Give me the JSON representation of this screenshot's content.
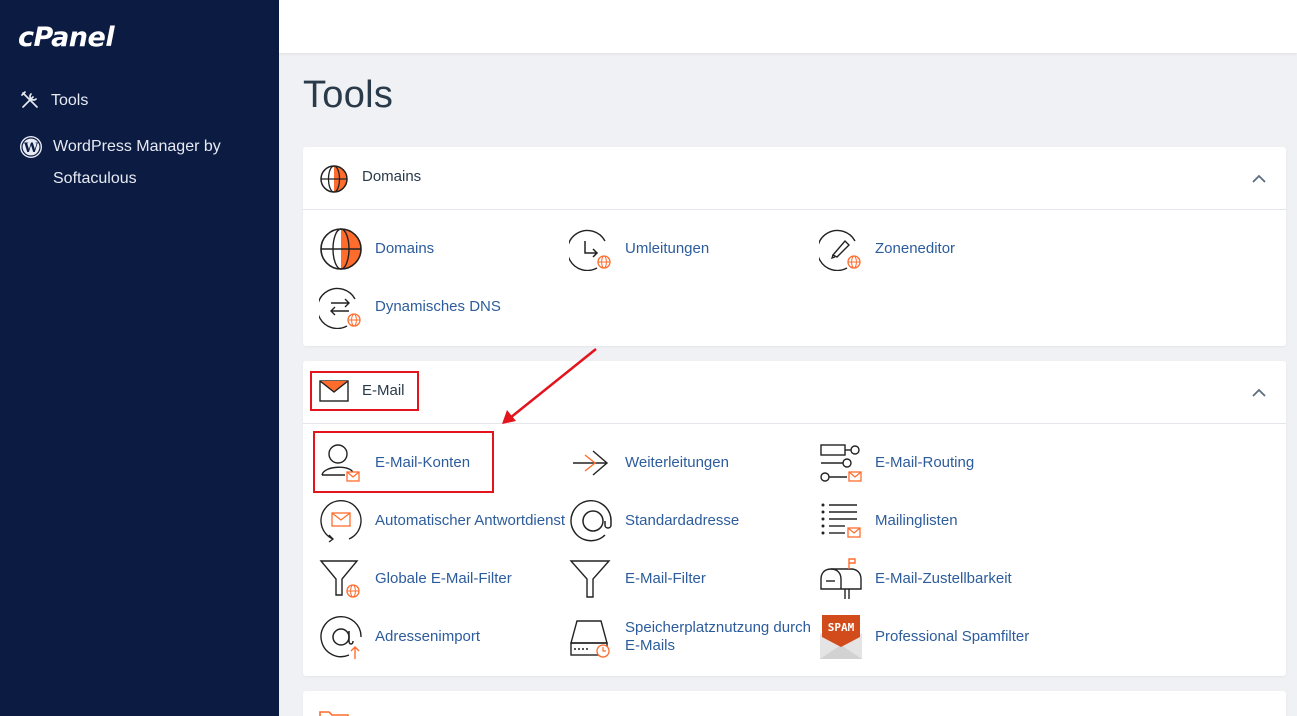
{
  "brand": {
    "logo": "cPanel"
  },
  "sidebar": {
    "items": [
      {
        "label": "Tools",
        "icon": "tools-icon"
      },
      {
        "label": "WordPress Manager by Softaculous",
        "icon": "wordpress-icon"
      }
    ]
  },
  "page": {
    "title": "Tools"
  },
  "sections": {
    "domains": {
      "title": "Domains",
      "tools": [
        {
          "label": "Domains",
          "icon": "globe-icon"
        },
        {
          "label": "Umleitungen",
          "icon": "redirect-icon"
        },
        {
          "label": "Zoneneditor",
          "icon": "zone-editor-icon"
        },
        {
          "label": "Dynamisches DNS",
          "icon": "dynamic-dns-icon"
        }
      ]
    },
    "email": {
      "title": "E-Mail",
      "tools": [
        {
          "label": "E-Mail-Konten",
          "icon": "email-accounts-icon"
        },
        {
          "label": "Weiterleitungen",
          "icon": "forwarders-icon"
        },
        {
          "label": "E-Mail-Routing",
          "icon": "email-routing-icon"
        },
        {
          "label": "Automatischer Antwortdienst",
          "icon": "autoresponder-icon"
        },
        {
          "label": "Standardadresse",
          "icon": "at-sign-icon"
        },
        {
          "label": "Mailinglisten",
          "icon": "mailing-list-icon"
        },
        {
          "label": "Globale E-Mail-Filter",
          "icon": "global-filter-icon"
        },
        {
          "label": "E-Mail-Filter",
          "icon": "filter-icon"
        },
        {
          "label": "E-Mail-Zustellbarkeit",
          "icon": "mailbox-icon"
        },
        {
          "label": "Adressenimport",
          "icon": "address-import-icon"
        },
        {
          "label": "Speicherplatznutzung durch E-Mails",
          "icon": "disk-usage-icon"
        },
        {
          "label": "Professional Spamfilter",
          "icon": "spam-icon",
          "badge": "SPAM"
        }
      ]
    }
  },
  "colors": {
    "sidebar": "#0b1b42",
    "accent": "#ff6c2c",
    "link": "#2c5c9c",
    "highlight": "#e3141b"
  }
}
